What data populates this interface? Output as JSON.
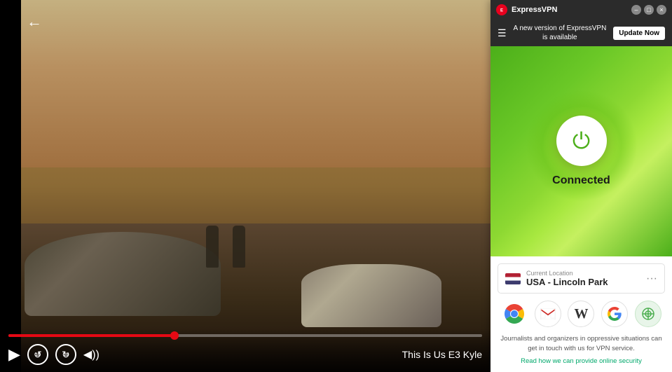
{
  "video": {
    "title": "This Is Us E3  Kyle",
    "back_label": "←",
    "progress_percent": 35
  },
  "controls": {
    "play_icon": "▶",
    "rewind_label": "10",
    "forward_label": "10",
    "volume_icon": "◀))",
    "rewind_arrow": "↺",
    "forward_arrow": "↻"
  },
  "vpn": {
    "app_name": "ExpressVPN",
    "titlebar": {
      "title": "ExpressVPN",
      "minimize": "–",
      "maximize": "□",
      "close": "×"
    },
    "banner": {
      "message": "A new version of ExpressVPN is available",
      "update_btn": "Update Now",
      "hamburger": "☰"
    },
    "status": {
      "connected_text": "Connected",
      "power_symbol": "⏻"
    },
    "location": {
      "label": "Current Location",
      "name": "USA - Lincoln Park",
      "menu_dots": "···"
    },
    "apps": [
      {
        "name": "Chrome",
        "symbol": "⊙"
      },
      {
        "name": "Gmail",
        "symbol": "M"
      },
      {
        "name": "Wikipedia",
        "symbol": "W"
      },
      {
        "name": "Google",
        "symbol": "G"
      },
      {
        "name": "Generic",
        "symbol": "⊕"
      }
    ],
    "footer": {
      "info_text": "Journalists and organizers in oppressive situations can get in touch with us for VPN service.",
      "link_text": "Read how we can provide online security"
    }
  }
}
